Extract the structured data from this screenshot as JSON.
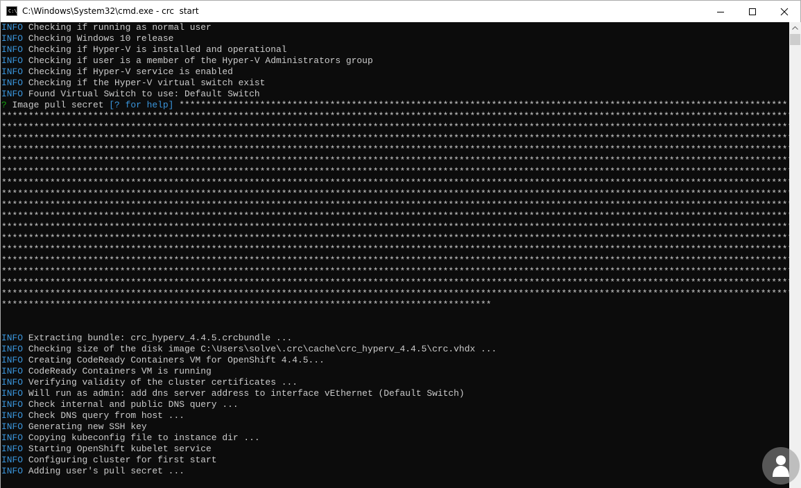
{
  "window": {
    "title": "C:\\Windows\\System32\\cmd.exe - crc  start",
    "icon": "cmd-prompt-icon",
    "controls": [
      "minimize-icon",
      "maximize-icon",
      "close-icon"
    ]
  },
  "console": {
    "colors": {
      "background": "#0c0c0c",
      "text": "#cccccc",
      "info_level": "#3a96dd",
      "prompt_mark": "#13a10e",
      "help_hint": "#3a96dd"
    },
    "lines": [
      {
        "level": "INFO",
        "text": "Checking if running as normal user"
      },
      {
        "level": "INFO",
        "text": "Checking Windows 10 release"
      },
      {
        "level": "INFO",
        "text": "Checking if Hyper-V is installed and operational"
      },
      {
        "level": "INFO",
        "text": "Checking if user is a member of the Hyper-V Administrators group"
      },
      {
        "level": "INFO",
        "text": "Checking if Hyper-V service is enabled"
      },
      {
        "level": "INFO",
        "text": "Checking if the Hyper-V virtual switch exist"
      },
      {
        "level": "INFO",
        "text": "Found Virtual Switch to use: Default Switch"
      },
      {
        "prompt": "?",
        "text": "Image pull secret",
        "hint": "[? for help]",
        "value": "*****************************************************************************************************************"
      },
      {
        "text": "*******************************************************************************************************************************************************************************************************************************************************************************"
      },
      {
        "text": "*******************************************************************************************************************************************************************************************************************************************************************************"
      },
      {
        "text": "*******************************************************************************************************************************************************************************************************************************************************************************"
      },
      {
        "text": "*******************************************************************************************************************************************************************************************************************************************************************************"
      },
      {
        "text": "*******************************************************************************************************************************************************************************************************************************************************************************"
      },
      {
        "text": "*******************************************************************************************************************************************************************************************************************************************************************************"
      },
      {
        "text": "*******************************************************************************************************************************************************************************************************************************************************************************"
      },
      {
        "text": "*******************************************************************************************************************************************************************************************************************************************************************************"
      },
      {
        "text": "*******************************************************************************************************************************************************************************************************************************************************************************"
      },
      {
        "text": "*******************************************************************************************************************************************************************************************************************************************************************************"
      },
      {
        "text": "*******************************************************************************************************************************************************************************************************************************************************************************"
      },
      {
        "text": "*******************************************************************************************************************************************************************************************************************************************************************************"
      },
      {
        "text": "*******************************************************************************************************************************************************************************************************************************************************************************"
      },
      {
        "text": "*******************************************************************************************************************************************************************************************************************************************************************************"
      },
      {
        "text": "*******************************************************************************************************************************************************************************************************************************************************************************"
      },
      {
        "text": "*******************************************************************************************************************************************************************************************************************************************************************************"
      },
      {
        "text": "*******************************************************************************************************************************************************************************************************************************************************************************"
      },
      {
        "text": "*******************************************************************************************"
      },
      {
        "text": ""
      },
      {
        "text": ""
      },
      {
        "level": "INFO",
        "text": "Extracting bundle: crc_hyperv_4.4.5.crcbundle ..."
      },
      {
        "level": "INFO",
        "text": "Checking size of the disk image C:\\Users\\solve\\.crc\\cache\\crc_hyperv_4.4.5\\crc.vhdx ..."
      },
      {
        "level": "INFO",
        "text": "Creating CodeReady Containers VM for OpenShift 4.4.5..."
      },
      {
        "level": "INFO",
        "text": "CodeReady Containers VM is running"
      },
      {
        "level": "INFO",
        "text": "Verifying validity of the cluster certificates ..."
      },
      {
        "level": "INFO",
        "text": "Will run as admin: add dns server address to interface vEthernet (Default Switch)"
      },
      {
        "level": "INFO",
        "text": "Check internal and public DNS query ..."
      },
      {
        "level": "INFO",
        "text": "Check DNS query from host ..."
      },
      {
        "level": "INFO",
        "text": "Generating new SSH key"
      },
      {
        "level": "INFO",
        "text": "Copying kubeconfig file to instance dir ..."
      },
      {
        "level": "INFO",
        "text": "Starting OpenShift kubelet service"
      },
      {
        "level": "INFO",
        "text": "Configuring cluster for first start"
      },
      {
        "level": "INFO",
        "text": "Adding user's pull secret ..."
      }
    ]
  },
  "watermark": {
    "icon": "person-silhouette-icon"
  }
}
